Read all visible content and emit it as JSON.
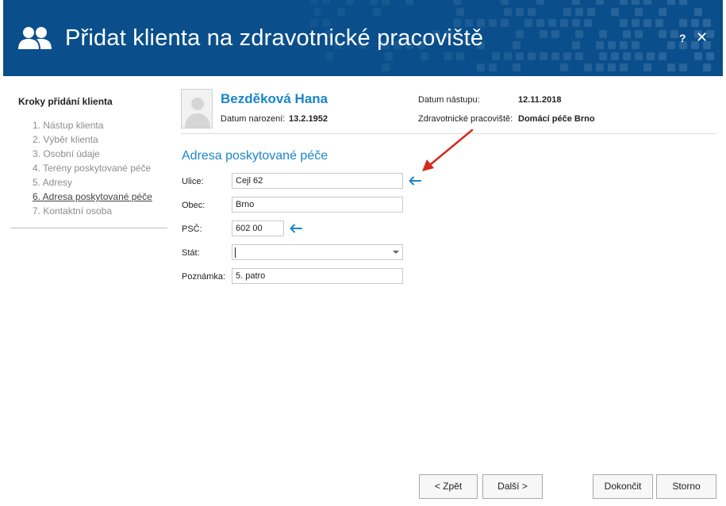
{
  "window": {
    "title": "Přidat klienta na zdravotnické pracoviště",
    "help_label": "?",
    "close_label": "✕",
    "icon": "users-icon"
  },
  "sidebar": {
    "title": "Kroky přidání klienta",
    "steps": [
      {
        "label": "1. Nástup klienta",
        "active": false
      },
      {
        "label": "2. Výběr klienta",
        "active": false
      },
      {
        "label": "3. Osobní údaje",
        "active": false
      },
      {
        "label": "4. Terény poskytované péče",
        "active": false
      },
      {
        "label": "5. Adresy",
        "active": false
      },
      {
        "label": "6. Adresa poskytované péče",
        "active": true
      },
      {
        "label": "7. Kontaktní osoba",
        "active": false
      }
    ]
  },
  "client": {
    "name": "Bezděková Hana",
    "birth_label": "Datum narození:",
    "birth_value": "13.2.1952",
    "start_label": "Datum nástupu:",
    "start_value": "12.11.2018",
    "workplace_label": "Zdravotnické pracoviště:",
    "workplace_value": "Domácí péče Brno"
  },
  "form": {
    "section_title": "Adresa poskytované péče",
    "street": {
      "label": "Ulice:",
      "value": "Cejl 62"
    },
    "city": {
      "label": "Obec:",
      "value": "Brno"
    },
    "zip": {
      "label": "PSČ:",
      "value": "602 00"
    },
    "country": {
      "label": "Stát:",
      "value": ""
    },
    "note": {
      "label": "Poznámka:",
      "value": "5. patro"
    }
  },
  "buttons": {
    "back": "< Zpět",
    "next": "Další >",
    "finish": "Dokončit",
    "cancel": "Storno"
  },
  "colors": {
    "header_bg": "#0a4f8c",
    "accent": "#1a86c8",
    "annotation_red": "#d42a20"
  }
}
